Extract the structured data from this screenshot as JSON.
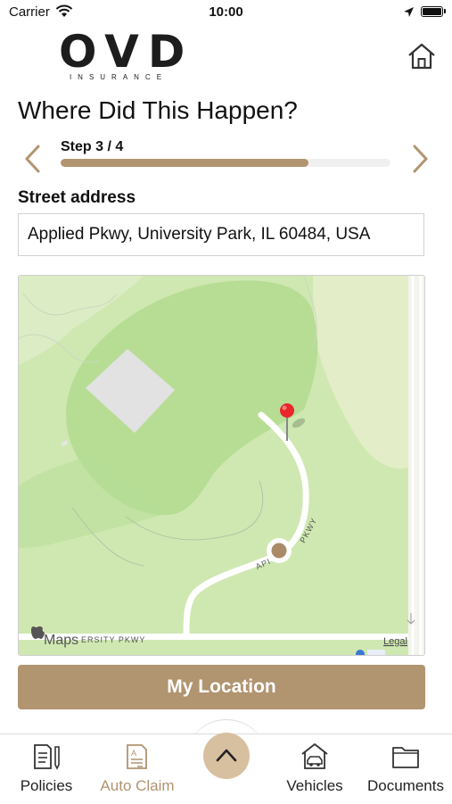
{
  "status_bar": {
    "carrier": "Carrier",
    "time": "10:00"
  },
  "brand": {
    "name": "OVD",
    "tagline": "INSURANCE"
  },
  "page": {
    "title": "Where Did This Happen?"
  },
  "stepper": {
    "label": "Step 3 / 4",
    "current": 3,
    "total": 4,
    "progress": 0.75
  },
  "form": {
    "street_label": "Street address",
    "street_value": "Applied Pkwy, University Park, IL 60484, USA"
  },
  "map": {
    "road_label_1": "PKWY",
    "road_label_prefix": "API",
    "road_label_2": "ERSITY PKWY",
    "attribution": "Maps",
    "legal": "Legal"
  },
  "actions": {
    "my_location": "My Location"
  },
  "tabs": [
    {
      "label": "Policies",
      "icon": "policies-icon",
      "active": false
    },
    {
      "label": "Auto Claim",
      "icon": "auto-claim-icon",
      "active": true
    },
    {
      "label": "Vehicles",
      "icon": "vehicles-icon",
      "active": false
    },
    {
      "label": "Documents",
      "icon": "documents-icon",
      "active": false
    }
  ],
  "colors": {
    "accent": "#b19470",
    "accent_light": "#d7c0a0",
    "map_green": "#cfe8b1",
    "map_dark_green": "#b7dd95",
    "pin": "#e8262b"
  }
}
